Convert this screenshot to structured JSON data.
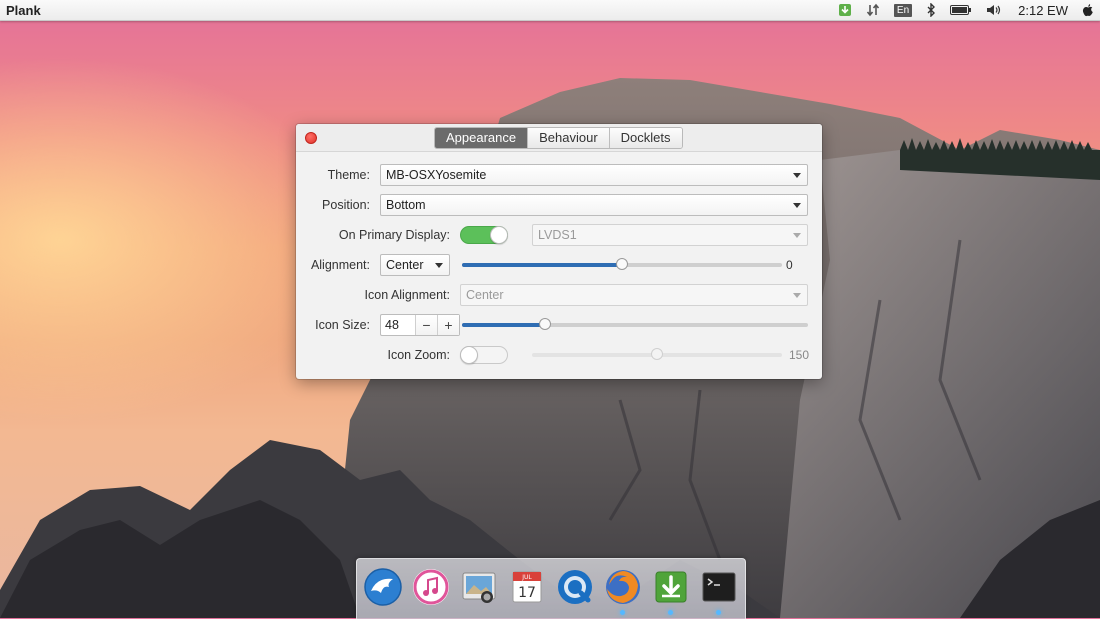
{
  "top_panel": {
    "app_name": "Plank",
    "keyboard_layout": "En",
    "clock": "2:12 EW",
    "tray_icons": [
      "update-manager-icon",
      "network-icon",
      "keyboard-layout-icon",
      "bluetooth-icon",
      "battery-icon",
      "volume-icon",
      "apple-logo-icon"
    ]
  },
  "window": {
    "tabs": [
      {
        "label": "Appearance",
        "active": true
      },
      {
        "label": "Behaviour",
        "active": false
      },
      {
        "label": "Docklets",
        "active": false
      }
    ],
    "theme": {
      "label": "Theme:",
      "value": "MB-OSXYosemite"
    },
    "position": {
      "label": "Position:",
      "value": "Bottom"
    },
    "primary_display": {
      "label": "On Primary Display:",
      "switch_on": true,
      "value": "LVDS1"
    },
    "alignment": {
      "label": "Alignment:",
      "value": "Center",
      "offset_value": "0",
      "offset_fraction": 0.5
    },
    "icon_alignment": {
      "label": "Icon Alignment:",
      "value": "Center"
    },
    "icon_size": {
      "label": "Icon Size:",
      "value": "48",
      "slider_fraction": 0.24
    },
    "icon_zoom": {
      "label": "Icon Zoom:",
      "switch_on": false,
      "value": "150",
      "slider_fraction": 0.5
    }
  },
  "dock": {
    "items": [
      {
        "icon": "eagle-finder-icon",
        "running": false
      },
      {
        "icon": "itunes-icon",
        "running": false
      },
      {
        "icon": "image-viewer-icon",
        "running": false
      },
      {
        "icon": "calendar-icon",
        "month": "JUL",
        "day": "17",
        "running": false
      },
      {
        "icon": "quicktime-icon",
        "running": false
      },
      {
        "icon": "firefox-icon",
        "running": true
      },
      {
        "icon": "software-updater-icon",
        "running": true
      },
      {
        "icon": "terminal-icon",
        "running": true
      }
    ]
  },
  "colors": {
    "accent_blue": "#2f6db3",
    "switch_green": "#5cc05a",
    "close_red": "#e0332a",
    "active_tab": "#6b6b6b"
  }
}
